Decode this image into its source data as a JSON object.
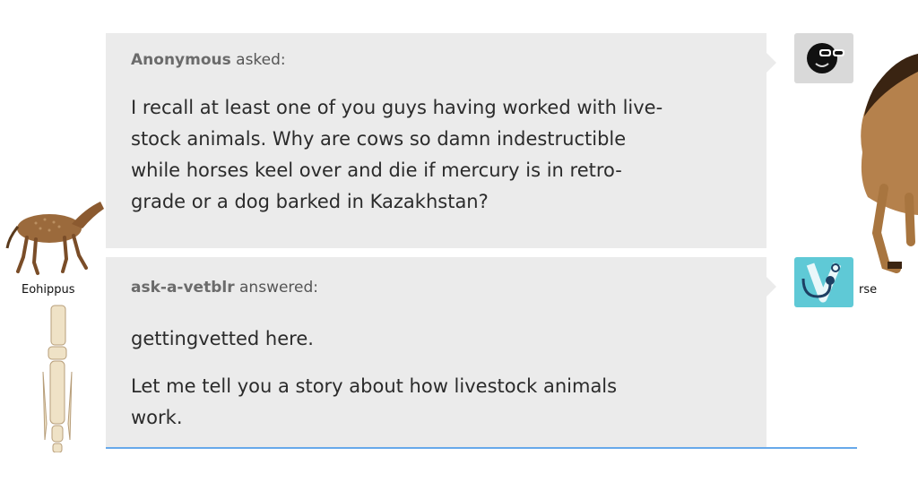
{
  "ask": {
    "sender": "Anonymous",
    "verb": "asked:",
    "lines": [
      "I recall at least one of you guys having worked with live-",
      "stock animals. Why are cows so damn indestructible",
      "while horses keel over and die if mercury is in retro-",
      "grade or a dog barked in Kazakhstan?"
    ]
  },
  "answer": {
    "sender": "ask-a-vetblr",
    "verb": "answered:",
    "paragraph1": "gettingvetted here.",
    "paragraph2_lines": [
      "Let me tell you a story about how livestock animals",
      "work."
    ]
  },
  "captions": {
    "left": "Eohippus",
    "right": "rse"
  },
  "avatars": {
    "anon_icon": "sunglasses-face-icon",
    "vet_icon": "stethoscope-v-icon",
    "vet_color": "#5fc9d6"
  },
  "colors": {
    "bubble": "#ebebeb",
    "underline": "#67a9ea"
  }
}
